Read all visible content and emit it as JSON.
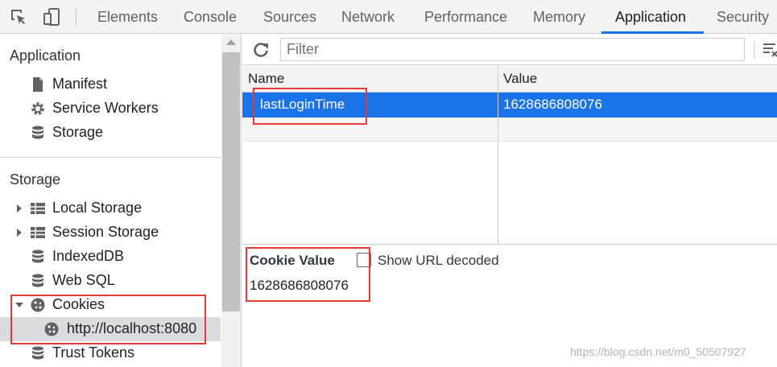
{
  "tabs": [
    {
      "label": "Elements",
      "active": false
    },
    {
      "label": "Console",
      "active": false
    },
    {
      "label": "Sources",
      "active": false
    },
    {
      "label": "Network",
      "active": false
    },
    {
      "label": "Performance",
      "active": false
    },
    {
      "label": "Memory",
      "active": false
    },
    {
      "label": "Application",
      "active": true
    },
    {
      "label": "Security",
      "active": false
    }
  ],
  "sidebar": {
    "application_heading": "Application",
    "application_items": [
      {
        "label": "Manifest",
        "icon": "document-icon"
      },
      {
        "label": "Service Workers",
        "icon": "gear-icon"
      },
      {
        "label": "Storage",
        "icon": "database-icon"
      }
    ],
    "storage_heading": "Storage",
    "storage_items": [
      {
        "label": "Local Storage",
        "icon": "table-icon",
        "expandable": true,
        "expanded": false
      },
      {
        "label": "Session Storage",
        "icon": "table-icon",
        "expandable": true,
        "expanded": false
      },
      {
        "label": "IndexedDB",
        "icon": "database-icon"
      },
      {
        "label": "Web SQL",
        "icon": "database-icon"
      },
      {
        "label": "Cookies",
        "icon": "cookie-icon",
        "expandable": true,
        "expanded": true
      },
      {
        "label": "http://localhost:8080",
        "icon": "cookie-icon",
        "selected": true
      },
      {
        "label": "Trust Tokens",
        "icon": "database-icon"
      }
    ]
  },
  "toolbar": {
    "filter_placeholder": "Filter"
  },
  "grid": {
    "columns": [
      "Name",
      "Value"
    ],
    "rows": [
      {
        "name": "lastLoginTime",
        "value": "1628686808076",
        "selected": true
      }
    ]
  },
  "cookie_value": {
    "title": "Cookie Value",
    "checkbox_label": "Show URL decoded",
    "checked": false,
    "value": "1628686808076"
  },
  "watermark": "https://blog.csdn.net/m0_50507927",
  "colors": {
    "accent": "#1a73e8",
    "annotation": "#e53935"
  }
}
